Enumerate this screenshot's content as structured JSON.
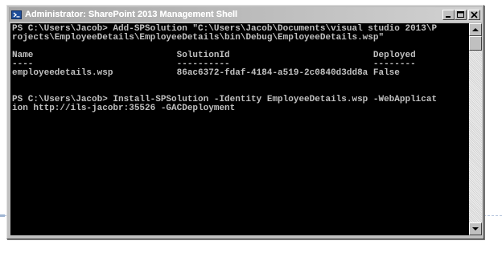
{
  "window": {
    "title": "Administrator: SharePoint 2013 Management Shell",
    "buttons": {
      "minimize": "minimize-icon",
      "maximize": "maximize-icon",
      "close": "close-icon"
    }
  },
  "console": {
    "lines": [
      "PS C:\\Users\\Jacob> Add-SPSolution \"C:\\Users\\Jacob\\Documents\\visual studio 2013\\P",
      "rojects\\EmployeeDetails\\EmployeeDetails\\bin\\Debug\\EmployeeDetails.wsp\"",
      "",
      "Name                           SolutionId                           Deployed",
      "----                           ----------                           --------",
      "employeedetails.wsp            86ac6372-fdaf-4184-a519-2c0840d3dd8a False",
      "",
      "",
      "PS C:\\Users\\Jacob> Install-SPSolution -Identity EmployeeDetails.wsp -WebApplicat",
      "ion http://ils-jacobr:35526 -GACDeployment"
    ]
  },
  "colors": {
    "console_bg": "#000000",
    "console_fg": "#c0c0c0",
    "title_fg": "#ffffff"
  }
}
